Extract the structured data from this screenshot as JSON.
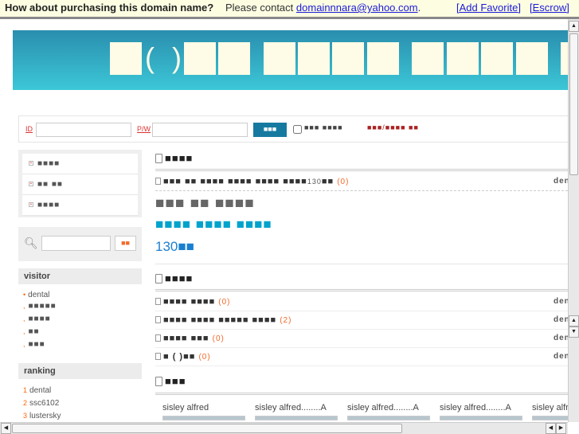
{
  "topbar": {
    "question": "How about purchasing this domain name?",
    "contact": "Please contact",
    "email": "domainnnara@yahoo.com",
    "period": ".",
    "add_favorite": "[Add Favorite]",
    "escrow": "[Escrow]"
  },
  "banner": {
    "paren_open": "(",
    "paren_close": ")"
  },
  "login": {
    "id_label": "ID",
    "pw_label": "P/W",
    "login_button": "■■■",
    "remember": "■■■ ■■■■",
    "join_links": "■■■/■■■■ ■■"
  },
  "sidebar": {
    "menu": [
      "■■■■",
      "■■ ■■",
      "■■■■"
    ],
    "search_button": "■■",
    "visitor_title": "visitor",
    "visitors": [
      "dental",
      "■■■■■",
      "■■■■",
      "■■",
      "■■■"
    ],
    "ranking_title": "ranking",
    "ranking": [
      {
        "rank": "1",
        "name": "dental"
      },
      {
        "rank": "2",
        "name": "ssc6102"
      },
      {
        "rank": "3",
        "name": "lustersky"
      }
    ]
  },
  "main": {
    "section1_title": "■■■■",
    "featured_row": {
      "title": "■■■ ■■ ■■■■ ■■■■ ■■■■ ■■■■",
      "num": "130",
      "suffix": "■■",
      "count": "(0)",
      "author": "dental"
    },
    "featured_big": "■■■ ■■ ■■■■",
    "featured_sub": "■■■■ ■■■■ ■■■■",
    "featured_num": "130",
    "featured_num_suffix": "■■",
    "section2_title": "■■■■",
    "rows": [
      {
        "title": "■■■■ ■■■■",
        "count": "(0)",
        "author": "dental"
      },
      {
        "title": "■■■■ ■■■■ ■■■■■ ■■■■",
        "count": "(2)",
        "author": "dental"
      },
      {
        "title": "■■■■ ■■■",
        "count": "(0)",
        "author": "dental"
      },
      {
        "title": "■ ( )■■",
        "count": "(0)",
        "author": "dental"
      }
    ],
    "section3_title": "■■■",
    "gallery": [
      "sisley alfred",
      "sisley alfred........A",
      "sisley alfred........A",
      "sisley alfred........A",
      "sisley alfred"
    ]
  },
  "colors": {
    "banner_top": "#2a8eae",
    "banner_bottom": "#3cc7d7",
    "accent_orange": "#f26a2a",
    "link_blue": "#1a1ad8"
  }
}
